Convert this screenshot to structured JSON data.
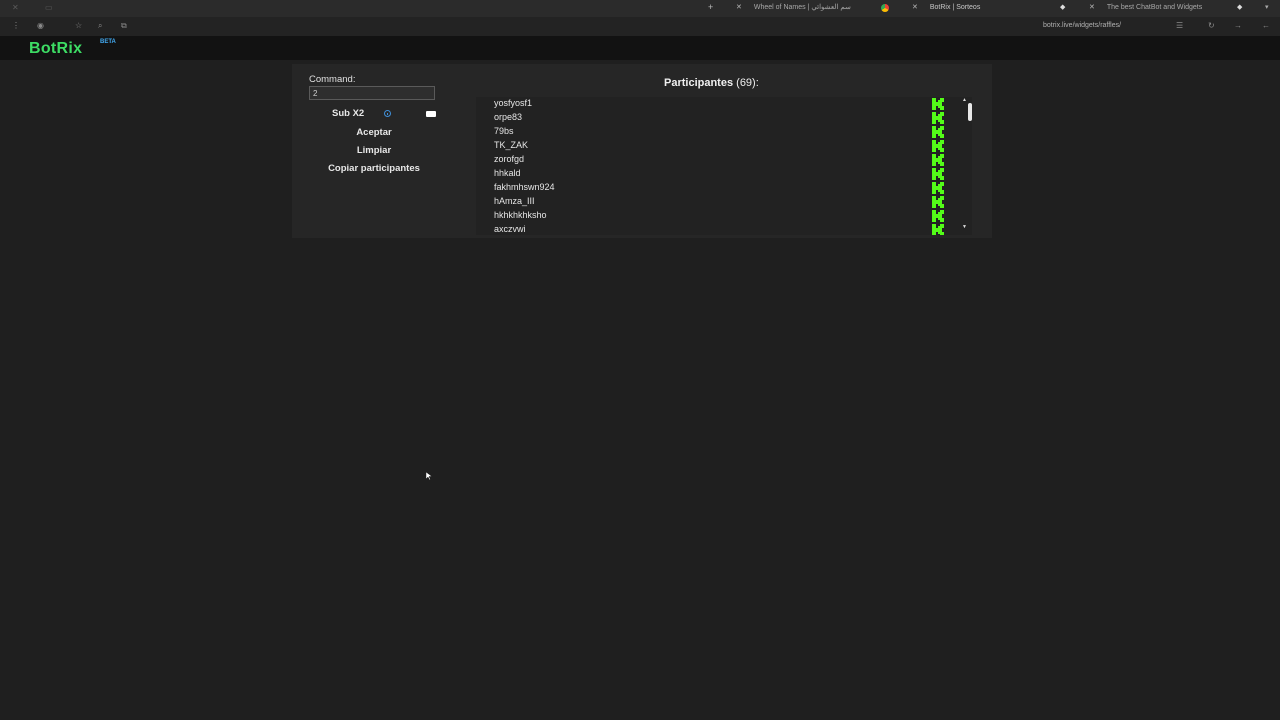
{
  "browser": {
    "tabs": [
      {
        "title": "Wheel of Names | سم العشوائي"
      },
      {
        "title": "BotRix | Sorteos",
        "active": true
      },
      {
        "title": "The best ChatBot and Widgets"
      }
    ],
    "url": "botrix.live/widgets/raffles/"
  },
  "site": {
    "logo": "BotRix",
    "badge": "BETA",
    "accent": "#3ddc64"
  },
  "raffle": {
    "command_label": "Command:",
    "command_value": "2",
    "sub_multiplier_label": "Sub X2",
    "sub_multiplier_enabled": true,
    "accept_label": "Aceptar",
    "clear_label": "Limpiar",
    "copy_label": "Copiar participantes",
    "participants_label": "Participantes",
    "participants_count": "(69):",
    "participants": [
      "yosfyosf1",
      "orpe83",
      "79bs",
      "TK_ZAK",
      "zorofgd",
      "hhkald",
      "fakhmhswn924",
      "hAmza_III",
      "hkhkhkhksho",
      "axczvwi"
    ],
    "platform_icon": "kick-icon",
    "platform_color": "#53fc18"
  }
}
